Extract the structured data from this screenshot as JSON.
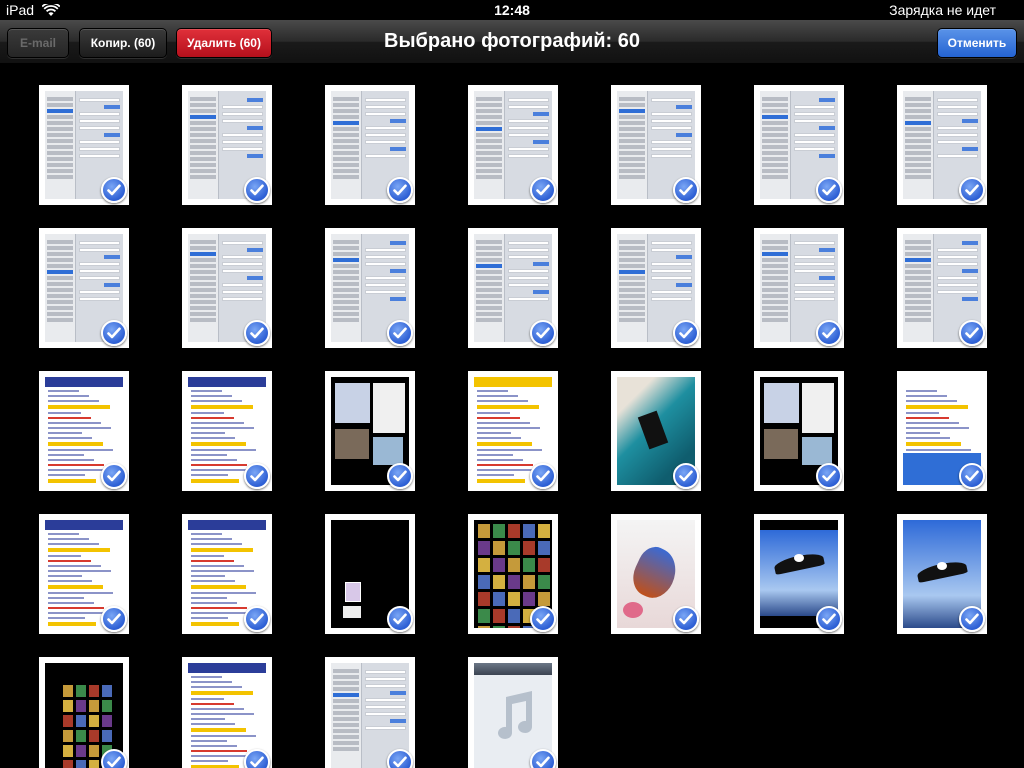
{
  "statusbar": {
    "device": "iPad",
    "time": "12:48",
    "battery_text": "Зарядка не идет"
  },
  "toolbar": {
    "email_label": "E-mail",
    "copy_label": "Копир. (60)",
    "delete_label": "Удалить (60)",
    "title": "Выбрано фотографий: 60",
    "cancel_label": "Отменить"
  },
  "colors": {
    "delete_red": "#c81e28",
    "cancel_blue": "#3a7be0",
    "check_blue": "#2d5fd4",
    "background": "#000000"
  },
  "icons": [
    "wifi-icon",
    "checkmark-icon",
    "music-note-icon"
  ],
  "photos": [
    {
      "kind": "settings"
    },
    {
      "kind": "settings"
    },
    {
      "kind": "settings"
    },
    {
      "kind": "settings"
    },
    {
      "kind": "settings"
    },
    {
      "kind": "settings"
    },
    {
      "kind": "settings"
    },
    {
      "kind": "settings"
    },
    {
      "kind": "settings"
    },
    {
      "kind": "settings"
    },
    {
      "kind": "settings"
    },
    {
      "kind": "settings"
    },
    {
      "kind": "settings"
    },
    {
      "kind": "settings"
    },
    {
      "kind": "web"
    },
    {
      "kind": "web"
    },
    {
      "kind": "dark-collage"
    },
    {
      "kind": "web-yellow"
    },
    {
      "kind": "photo-teal"
    },
    {
      "kind": "dark-collage"
    },
    {
      "kind": "web-blue"
    },
    {
      "kind": "web"
    },
    {
      "kind": "web-list"
    },
    {
      "kind": "dark-small"
    },
    {
      "kind": "dark-grid"
    },
    {
      "kind": "photo-bird"
    },
    {
      "kind": "photo-eagle"
    },
    {
      "kind": "photo-eagle-big"
    },
    {
      "kind": "dark-grid-small"
    },
    {
      "kind": "web-list"
    },
    {
      "kind": "settings"
    },
    {
      "kind": "music"
    }
  ]
}
